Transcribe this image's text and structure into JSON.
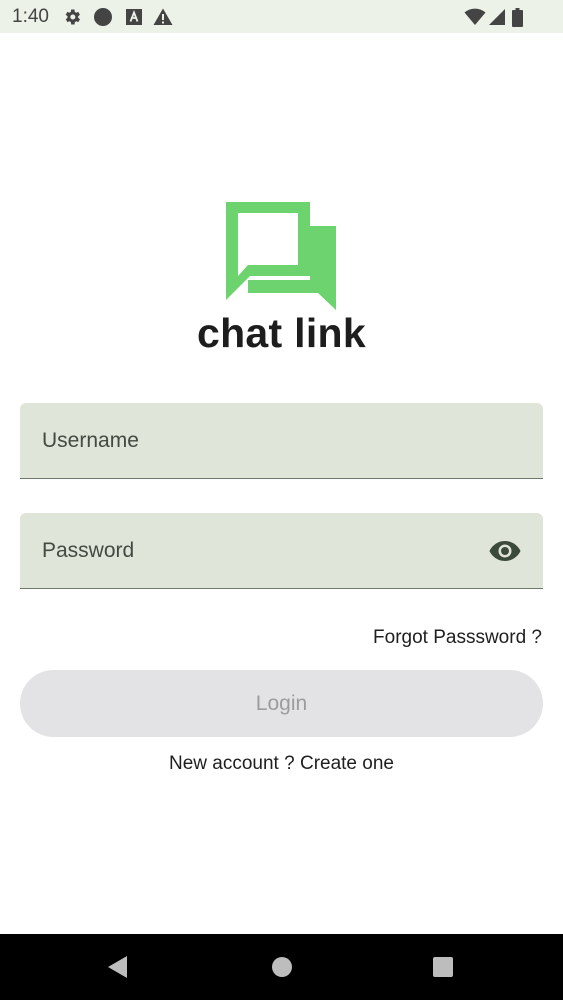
{
  "status_bar": {
    "time": "1:40",
    "left_icons": [
      "settings-gear-icon",
      "circle-icon",
      "font-a-icon",
      "warning-icon"
    ],
    "right_icons": [
      "wifi-icon",
      "signal-icon",
      "battery-icon"
    ]
  },
  "app": {
    "title": "chat link",
    "logo_color": "#6cd36e"
  },
  "form": {
    "username": {
      "placeholder": "Username",
      "value": ""
    },
    "password": {
      "placeholder": "Password",
      "value": ""
    },
    "forgot_label": "Forgot Passsword ?",
    "login_label": "Login",
    "signup_prefix": "New account ? ",
    "signup_link": "Create one"
  },
  "colors": {
    "field_bg": "#dfe5d8",
    "button_bg": "#e3e3e6",
    "status_bg": "#ecf2e8"
  },
  "nav_bar": {
    "buttons": [
      "back-icon",
      "home-icon",
      "recents-icon"
    ]
  }
}
